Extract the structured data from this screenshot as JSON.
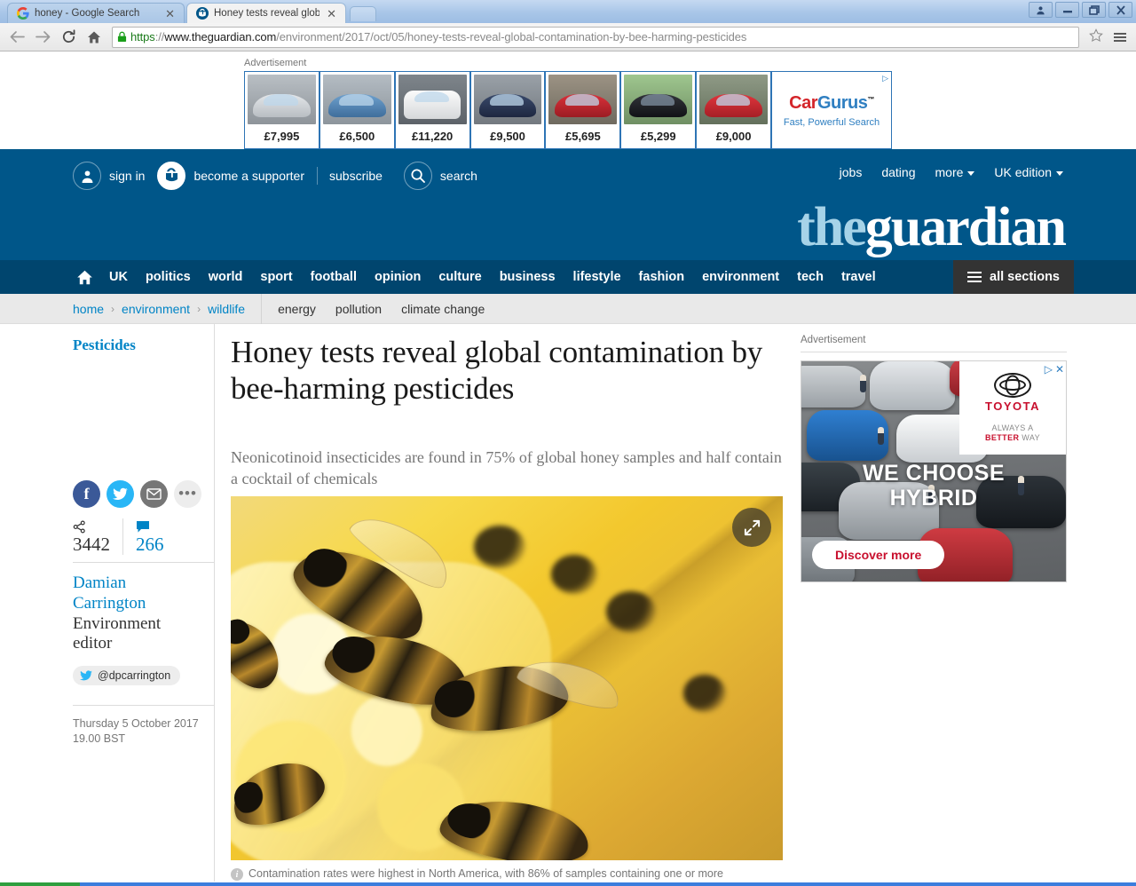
{
  "browser": {
    "tabs": [
      {
        "title": "honey - Google Search",
        "favicon": "google-icon",
        "active": false
      },
      {
        "title": "Honey tests reveal global co",
        "favicon": "guardian-icon",
        "active": true
      }
    ],
    "new_tab_label": "",
    "back_label": "←",
    "forward_label": "→",
    "reload_label": "↻",
    "home_label": "⌂",
    "url_scheme": "https",
    "url_sep": "://",
    "url_host": "www.theguardian.com",
    "url_path": "/environment/2017/oct/05/honey-tests-reveal-global-contamination-by-bee-harming-pesticides",
    "bookmark_label": "☆",
    "window_buttons": {
      "user": "●",
      "minimize": "–",
      "restore": "❐",
      "close": "✕"
    }
  },
  "top_ad": {
    "label": "Advertisement",
    "cars": [
      {
        "price": "£7,995",
        "color": "#d7dade"
      },
      {
        "price": "£6,500",
        "color": "#5d93c4"
      },
      {
        "price": "£11,220",
        "color": "#f0f0f0"
      },
      {
        "price": "£9,500",
        "color": "#2b3a57"
      },
      {
        "price": "£5,695",
        "color": "#c1242c"
      },
      {
        "price": "£5,299",
        "color": "#1e1e22"
      },
      {
        "price": "£9,000",
        "color": "#cf2b2b"
      }
    ],
    "brand_part1": "Car",
    "brand_part2": "Gurus",
    "brand_tm": "™",
    "tagline": "Fast, Powerful Search",
    "adchoices": "▷"
  },
  "header": {
    "sign_in": "sign in",
    "become_supporter": "become a supporter",
    "subscribe": "subscribe",
    "search": "search",
    "right_links": [
      {
        "label": "jobs",
        "caret": false
      },
      {
        "label": "dating",
        "caret": false
      },
      {
        "label": "more",
        "caret": true
      },
      {
        "label": "UK edition",
        "caret": true
      }
    ],
    "logo_the": "the",
    "logo_guardian": "guardian",
    "brand_blue": "#005689",
    "nav_blue": "#00456e"
  },
  "nav": {
    "home_icon": "home-icon",
    "items": [
      "UK",
      "politics",
      "world",
      "sport",
      "football",
      "opinion",
      "culture",
      "business",
      "lifestyle",
      "fashion",
      "environment",
      "tech",
      "travel"
    ],
    "all_sections": "all sections"
  },
  "subnav": {
    "breadcrumb": [
      "home",
      "environment",
      "wildlife"
    ],
    "separator": "›",
    "links": [
      "energy",
      "pollution",
      "climate change"
    ]
  },
  "article": {
    "kicker": "Pesticides",
    "headline": "Honey tests reveal global contamination by bee-harming pesticides",
    "standfirst": "Neonicotinoid insecticides are found in 75% of global honey samples and half contain a cocktail of chemicals",
    "share": {
      "facebook": "f",
      "twitter": "twitter-icon",
      "email": "email-icon",
      "more": "•••"
    },
    "share_count": "3442",
    "comment_count": "266",
    "author_line1": "Damian",
    "author_line2": "Carrington",
    "author_role_line1": "Environment",
    "author_role_line2": "editor",
    "twitter_handle": "@dpcarrington",
    "pub_date": "Thursday 5 October 2017",
    "pub_time": "19.00 BST",
    "caption": "Contamination rates were highest in North America, with 86% of samples containing one or more",
    "expand_icon": "expand-icon"
  },
  "right_ad": {
    "label": "Advertisement",
    "brand": "TOYOTA",
    "slogan_part1": "ALWAYS A",
    "slogan_part2": "BETTER",
    "slogan_part3": "WAY",
    "hero_line1": "WE CHOOSE",
    "hero_line2": "HYBRID",
    "cta": "Discover more",
    "adchoices": "▷",
    "close": "✕"
  }
}
